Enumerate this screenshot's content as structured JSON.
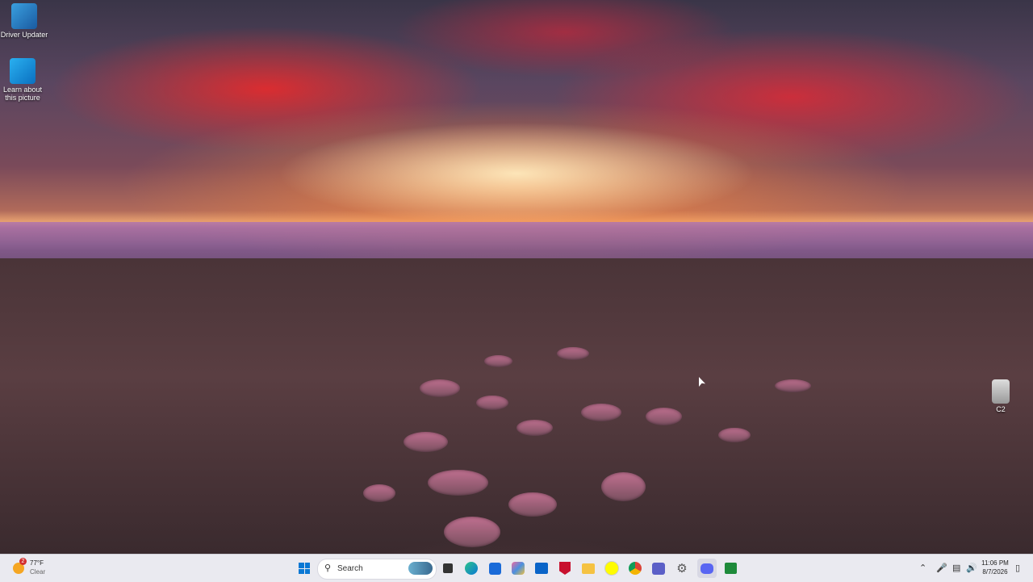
{
  "desktop": {
    "icons": [
      {
        "label": "Driver Updater",
        "icon": "driver-updater-icon"
      },
      {
        "label": "Learn about this picture",
        "icon": "learn-picture-icon"
      },
      {
        "label": "C2",
        "icon": "file-icon"
      }
    ]
  },
  "weather": {
    "badge": "2",
    "temp": "77°F",
    "condition": "Clear"
  },
  "taskbar": {
    "search_placeholder": "Search",
    "apps": [
      "start-icon",
      "search-icon",
      "task-view-icon",
      "edge-icon",
      "store-icon",
      "copilot-icon",
      "outlook-icon",
      "mcafee-icon",
      "file-explorer-icon",
      "snapchat-icon",
      "chrome-icon",
      "teams-icon",
      "settings-icon",
      "discord-icon",
      "terminal-icon"
    ]
  },
  "clock": {
    "time": "11:06 PM",
    "date": "8/7/2026"
  },
  "colors": {
    "taskbar": "#eaeaf0",
    "accent": "#0067c0"
  }
}
